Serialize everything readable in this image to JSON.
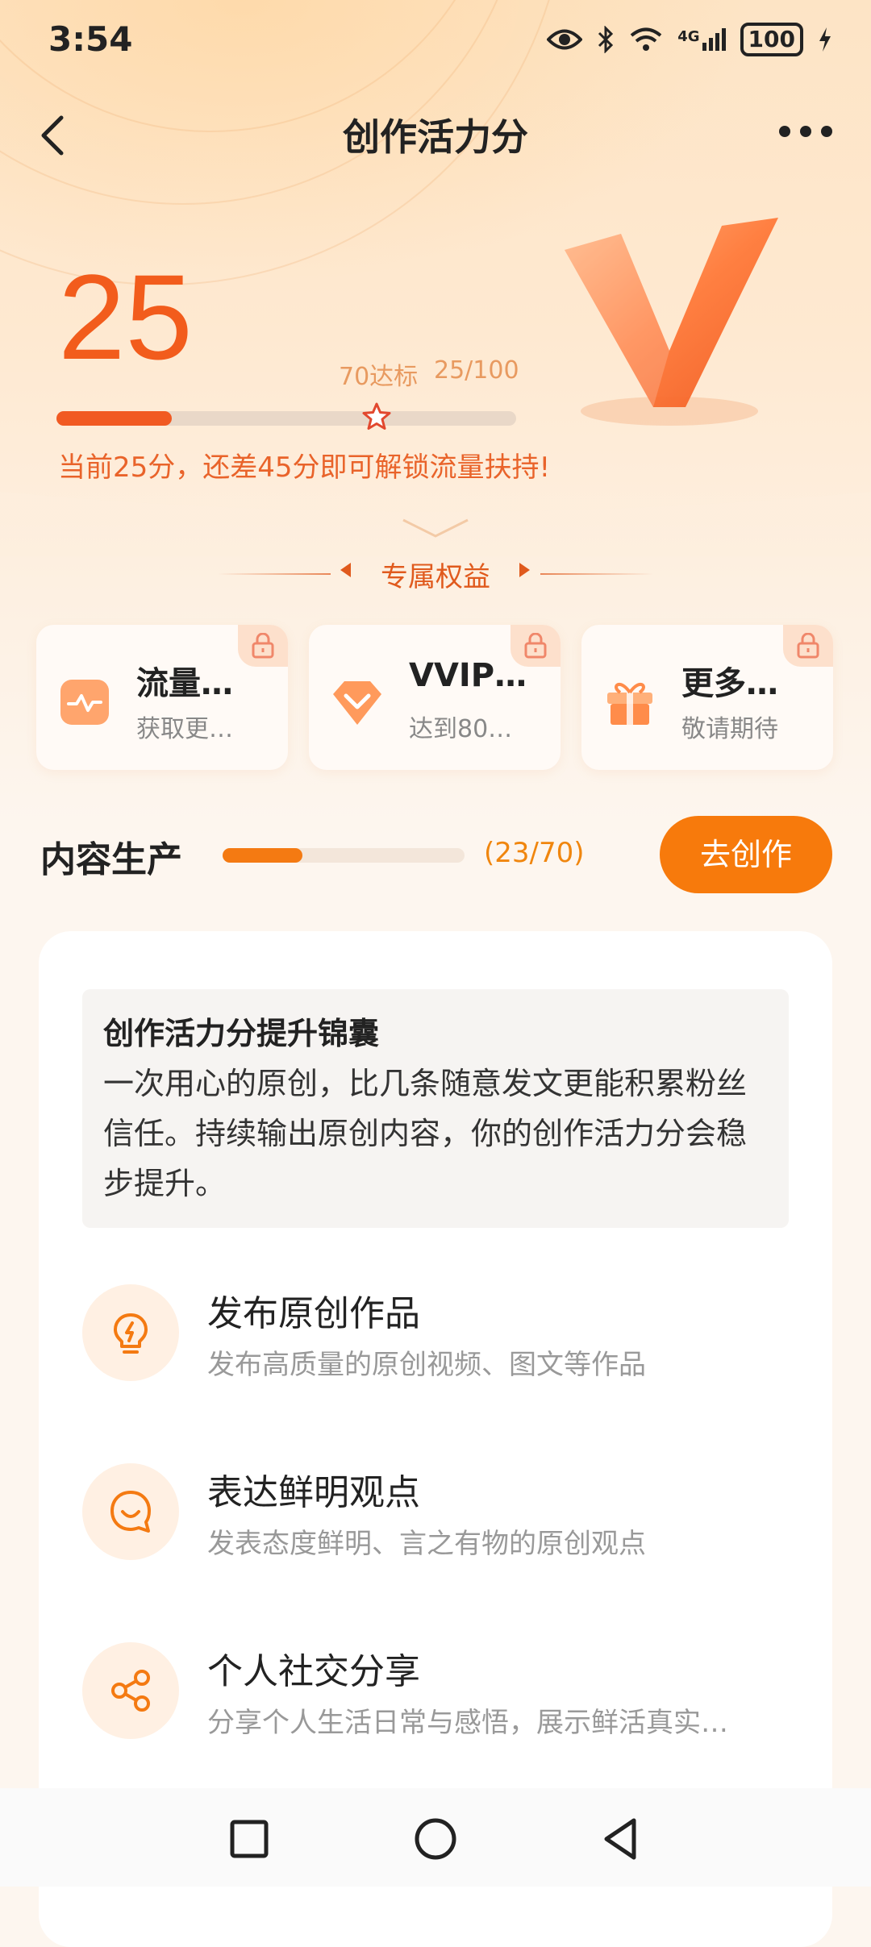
{
  "status": {
    "time": "3:54",
    "network": "4G",
    "battery": "100"
  },
  "nav": {
    "title": "创作活力分"
  },
  "score": {
    "value": "25",
    "target_label": "70达标",
    "ratio": "25/100",
    "progress": 0.25,
    "star_position": 0.7,
    "tip": "当前25分，还差45分即可解锁流量扶持!"
  },
  "benefits": {
    "title": "专属权益",
    "items": [
      {
        "title": "流量…",
        "subtitle": "获取更…",
        "icon": "traffic-icon"
      },
      {
        "title": "VVIP…",
        "subtitle": "达到80…",
        "icon": "diamond-icon"
      },
      {
        "title": "更多…",
        "subtitle": "敬请期待",
        "icon": "gift-icon"
      }
    ]
  },
  "content": {
    "title": "内容生产",
    "count": "(23/70)",
    "progress": 0.3286,
    "button": "去创作",
    "tip_title": "创作活力分提升锦囊",
    "tip_body": "一次用心的原创，比几条随意发文更能积累粉丝信任。持续输出原创内容，你的创作活力分会稳步提升。",
    "items": [
      {
        "title": "发布原创作品",
        "subtitle": "发布高质量的原创视频、图文等作品",
        "icon": "lightbulb-icon"
      },
      {
        "title": "表达鲜明观点",
        "subtitle": "发表态度鲜明、言之有物的原创观点",
        "icon": "chat-smile-icon"
      },
      {
        "title": "个人社交分享",
        "subtitle": "分享个人生活日常与感悟，展示鲜活真实…",
        "icon": "share-icon"
      }
    ]
  },
  "colors": {
    "accent": "#f15a22",
    "button": "#f77a0c",
    "tip": "#e9632a"
  }
}
